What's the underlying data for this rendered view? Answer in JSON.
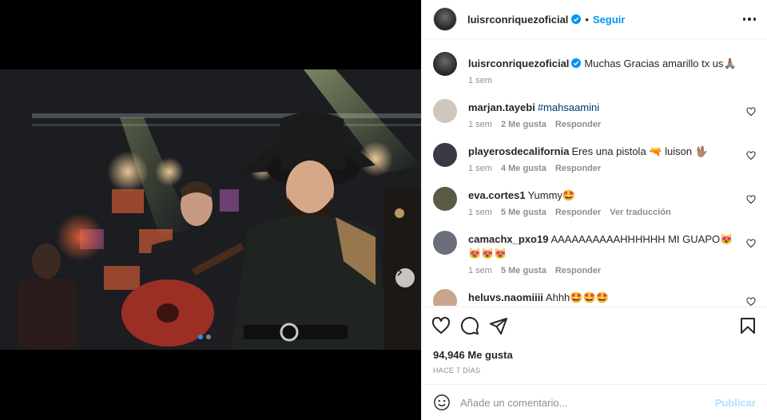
{
  "post": {
    "author": "luisrconriquezoficial",
    "follow_label": "Seguir",
    "separator": "•"
  },
  "caption": {
    "username": "luisrconriquezoficial",
    "text": "Muchas Gracias amarillo tx us🙏🏽",
    "time": "1 sem"
  },
  "comments": [
    {
      "username": "marjan.tayebi",
      "text": "",
      "tag": "#mahsaamini",
      "time": "1 sem",
      "likes": "2 Me gusta",
      "reply": "Responder",
      "translate": "",
      "avatar_color": "#cfc6bd"
    },
    {
      "username": "playerosdecalifornia",
      "text": "Eres una pistola 🔫 luison 🖖🏽",
      "tag": "",
      "time": "1 sem",
      "likes": "4 Me gusta",
      "reply": "Responder",
      "translate": "",
      "avatar_color": "#3a3a44"
    },
    {
      "username": "eva.cortes1",
      "text": "Yummy🤩",
      "tag": "",
      "time": "1 sem",
      "likes": "5 Me gusta",
      "reply": "Responder",
      "translate": "Ver traducción",
      "avatar_color": "#5b5a45"
    },
    {
      "username": "camachx_pxo19",
      "text": "AAAAAAAAAAHHHHHH MI GUAPO😻😻😻😻",
      "tag": "",
      "time": "1 sem",
      "likes": "5 Me gusta",
      "reply": "Responder",
      "translate": "",
      "avatar_color": "#6b6f7c"
    },
    {
      "username": "heluvs.naomiiii",
      "text": "Ahhh🤩🤩🤩",
      "tag": "",
      "time": "",
      "likes": "",
      "reply": "",
      "translate": "",
      "avatar_color": "#c9a58d"
    }
  ],
  "engagement": {
    "likes": "94,946 Me gusta",
    "time_ago": "HACE 7 DÍAS"
  },
  "composer": {
    "placeholder": "Añade un comentario...",
    "publish_label": "Publicar"
  },
  "colors": {
    "accent": "#0095f6",
    "publish_disabled": "#b2dffc",
    "carousel_active_dot": "#2196f3"
  },
  "icons": [
    "verified-badge-icon",
    "more-options-icon",
    "heart-icon",
    "comment-icon",
    "share-icon",
    "bookmark-icon",
    "emoji-icon",
    "chevron-right-icon"
  ]
}
